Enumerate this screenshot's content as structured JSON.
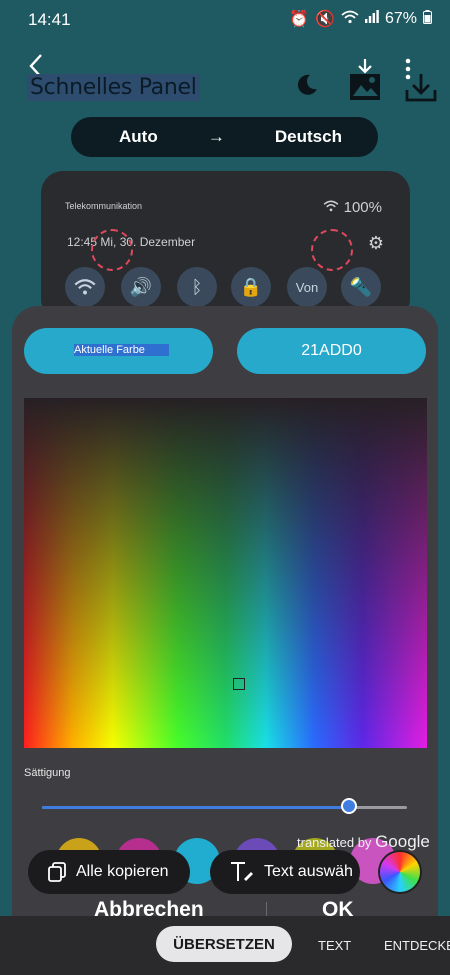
{
  "status": {
    "time": "14:41",
    "battery": "67%"
  },
  "header": {
    "title": "Schnelles Panel"
  },
  "translate": {
    "source_lang": "Auto",
    "arrow": "→",
    "target_lang": "Deutsch"
  },
  "preview": {
    "operator": "Telekommunikation",
    "battery": "100%",
    "datetime": "12:45 Mi, 30. Dezember",
    "tile_text": "Von"
  },
  "picker": {
    "current_color_label": "Aktuelle Farbe",
    "hex_value": "21ADD0",
    "saturation_label": "Sättigung",
    "saturation_value": 0.84,
    "cancel_label": "Abbrechen",
    "ok_label": "OK",
    "swatch_colors": [
      "#c9a21a",
      "#b62f8f",
      "#21add0",
      "#6a4bb8",
      "#a3a81f",
      "#c954c0"
    ]
  },
  "overlay": {
    "translated_by_prefix": "translated by",
    "translated_by_brand": "Google",
    "copy_all": "Alle kopieren",
    "select_text": "Text auswäh"
  },
  "bottom": {
    "tab_translate": "ÜBERSETZEN",
    "tab_text": "TEXT",
    "tab_discover": "ENTDECKE"
  },
  "colors": {
    "accent": "#27a9cb",
    "slider": "#3f7de0",
    "sheet_bg": "#3e3d42",
    "page_bg": "#1f5a62"
  }
}
